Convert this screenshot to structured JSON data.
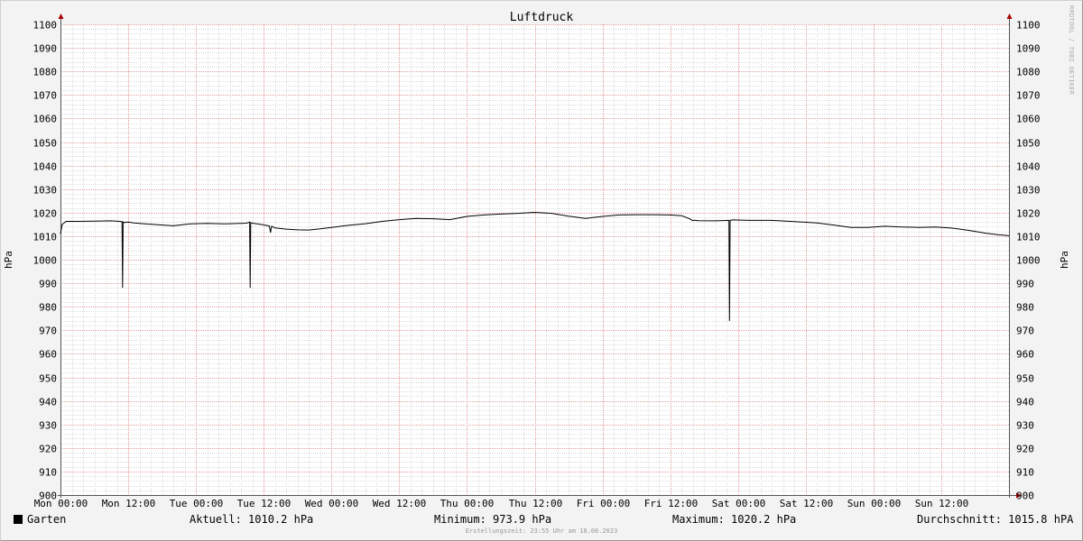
{
  "chart_data": {
    "type": "line",
    "title": "Luftdruck",
    "ylabel": "hPa",
    "ylabel_right": "hPa",
    "ylim": [
      900,
      1100
    ],
    "y_ticks": [
      900,
      910,
      920,
      930,
      940,
      950,
      960,
      970,
      980,
      990,
      1000,
      1010,
      1020,
      1030,
      1040,
      1050,
      1060,
      1070,
      1080,
      1090,
      1100
    ],
    "x_unit": "hours since Mon 00:00",
    "xlim": [
      0,
      168
    ],
    "x_ticks": [
      {
        "h": 0,
        "label": "Mon 00:00"
      },
      {
        "h": 12,
        "label": "Mon 12:00"
      },
      {
        "h": 24,
        "label": "Tue 00:00"
      },
      {
        "h": 36,
        "label": "Tue 12:00"
      },
      {
        "h": 48,
        "label": "Wed 00:00"
      },
      {
        "h": 60,
        "label": "Wed 12:00"
      },
      {
        "h": 72,
        "label": "Thu 00:00"
      },
      {
        "h": 84,
        "label": "Thu 12:00"
      },
      {
        "h": 96,
        "label": "Fri 00:00"
      },
      {
        "h": 108,
        "label": "Fri 12:00"
      },
      {
        "h": 120,
        "label": "Sat 00:00"
      },
      {
        "h": 132,
        "label": "Sat 12:00"
      },
      {
        "h": 144,
        "label": "Sun 00:00"
      },
      {
        "h": 156,
        "label": "Sun 12:00"
      }
    ],
    "grid": true,
    "series": [
      {
        "name": "Garten",
        "color": "#000000",
        "x": [
          0,
          0.3,
          1,
          3,
          6,
          9,
          10.9,
          11.0,
          11.1,
          11.3,
          12,
          13,
          15,
          17,
          20,
          23,
          26,
          29,
          33,
          33.5,
          33.6,
          33.7,
          34,
          36,
          37,
          37.2,
          37.4,
          38,
          40,
          42,
          44,
          46,
          48,
          51,
          54,
          57,
          60,
          63,
          66,
          69,
          72,
          75,
          78,
          81,
          84,
          87,
          90,
          93,
          96,
          99,
          102,
          105,
          108,
          110,
          111.5,
          112,
          112.3,
          113,
          116,
          118.4,
          118.5,
          118.6,
          119,
          122,
          126,
          130,
          134,
          137,
          140,
          143,
          146,
          149,
          152,
          155,
          158,
          161,
          164,
          166,
          168
        ],
        "y": [
          1011,
          1015,
          1016.3,
          1016.3,
          1016.4,
          1016.5,
          1016.2,
          988,
          1016,
          1015.8,
          1016,
          1015.6,
          1015.2,
          1014.9,
          1014.4,
          1015.2,
          1015.4,
          1015.2,
          1015.5,
          1016,
          988,
          1015.7,
          1015.5,
          1014.8,
          1014.3,
          1011.5,
          1014.2,
          1013.5,
          1013,
          1012.7,
          1012.6,
          1013.1,
          1013.7,
          1014.6,
          1015.3,
          1016.3,
          1017,
          1017.5,
          1017.4,
          1017,
          1018.4,
          1019,
          1019.4,
          1019.7,
          1020.1,
          1019.7,
          1018.5,
          1017.5,
          1018.4,
          1019,
          1019.1,
          1019.1,
          1019,
          1018.7,
          1017.3,
          1016.6,
          1016.8,
          1016.6,
          1016.5,
          1016.7,
          974,
          1016.7,
          1016.9,
          1016.7,
          1016.7,
          1016.2,
          1015.6,
          1014.7,
          1013.7,
          1013.7,
          1014.2,
          1013.9,
          1013.7,
          1013.9,
          1013.4,
          1012.4,
          1011.2,
          1010.6,
          1010.2
        ]
      }
    ]
  },
  "legend": {
    "series_name": "Garten",
    "current": "Aktuell: 1010.2 hPa",
    "minimum": "Minimum: 973.9 hPa",
    "maximum": "Maximum: 1020.2 hPa",
    "average": "Durchschnitt: 1015.8 hPA"
  },
  "footer": "Erstellungszeit: 23:55 Uhr am 18.06.2023",
  "watermark": "RRDTOOL / TOBI OETIKER",
  "colors": {
    "plot_background": "#ffffff",
    "grid_major": "#e39c9c",
    "grid_minor": "#dedede",
    "axis": "#555555",
    "line": "#000000"
  }
}
